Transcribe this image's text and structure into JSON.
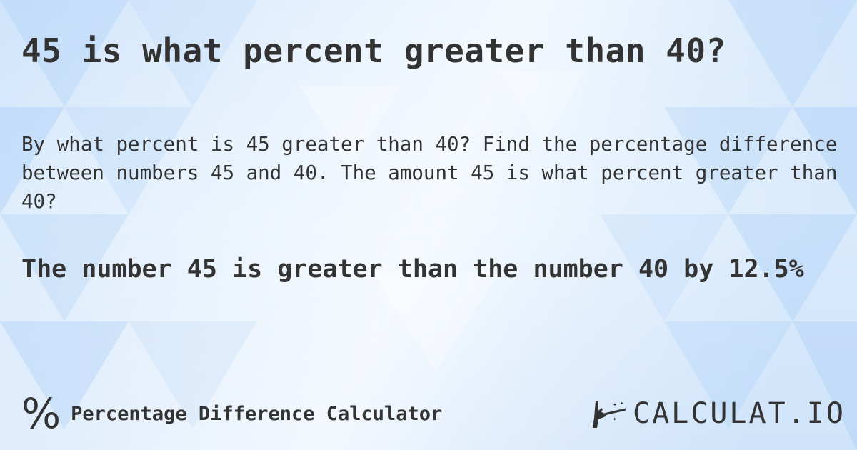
{
  "title": "45 is what percent greater than 40?",
  "description": "By what percent is 45 greater than 40? Find the percentage difference between numbers 45 and 40. The amount 45 is what percent greater than 40?",
  "answer": "The number 45 is greater than the number 40 by 12.5%",
  "footer": {
    "icon": "percent-icon",
    "calculator_name": "Percentage Difference Calculator",
    "logo_icon": "magic-wand-hand-icon",
    "logo_text": "CALCULAT.IO"
  },
  "colors": {
    "text": "#333333",
    "background": "#cfe4fb"
  }
}
